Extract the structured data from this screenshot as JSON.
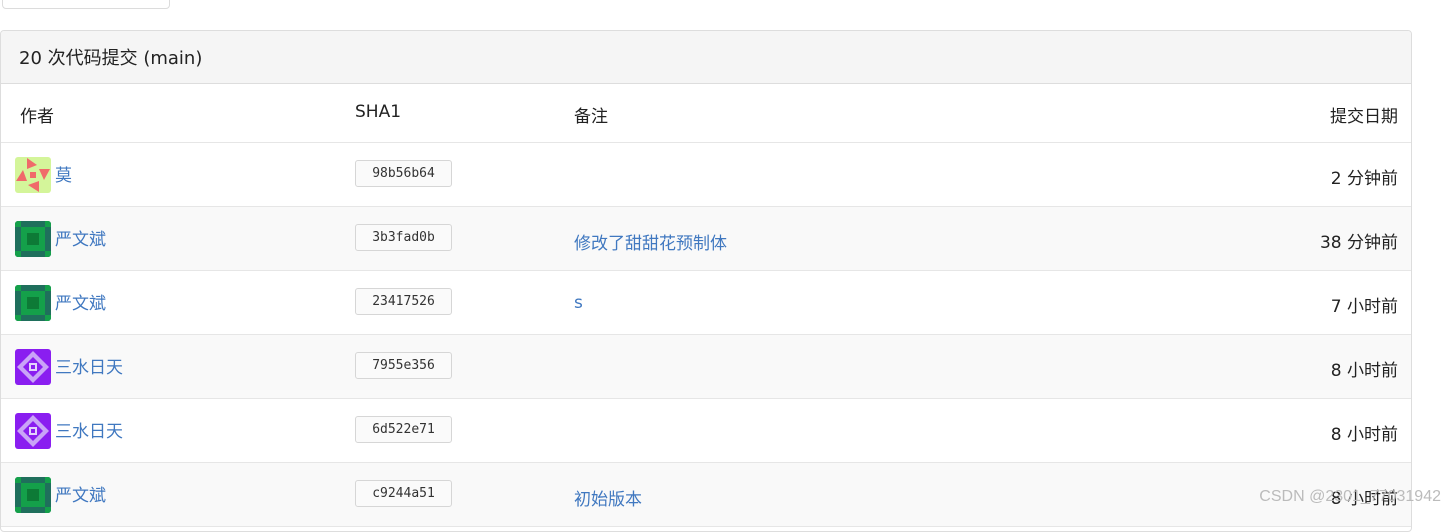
{
  "panel": {
    "title": "20 次代码提交 (main)"
  },
  "columns": {
    "author": "作者",
    "sha": "SHA1",
    "message": "备注",
    "date": "提交日期"
  },
  "commits": [
    {
      "author": "莫",
      "sha": "98b56b64",
      "message": "",
      "date": "2 分钟前",
      "avatar": "avatar-triangles-icon"
    },
    {
      "author": "严文斌",
      "sha": "3b3fad0b",
      "message": "修改了甜甜花预制体",
      "date": "38 分钟前",
      "avatar": "avatar-green-pattern-icon"
    },
    {
      "author": "严文斌",
      "sha": "23417526",
      "message": "s",
      "date": "7 小时前",
      "avatar": "avatar-green-pattern-icon"
    },
    {
      "author": "三水日天",
      "sha": "7955e356",
      "message": "",
      "date": "8 小时前",
      "avatar": "avatar-purple-diamond-icon"
    },
    {
      "author": "三水日天",
      "sha": "6d522e71",
      "message": "",
      "date": "8 小时前",
      "avatar": "avatar-purple-diamond-icon"
    },
    {
      "author": "严文斌",
      "sha": "c9244a51",
      "message": "初始版本",
      "date": "8 小时前",
      "avatar": "avatar-green-pattern-icon"
    }
  ],
  "watermark": "CSDN @2301_77031942",
  "colors": {
    "link": "#4078c0",
    "header_bg": "#f5f5f5",
    "alt_row_bg": "#f9f9f9"
  }
}
